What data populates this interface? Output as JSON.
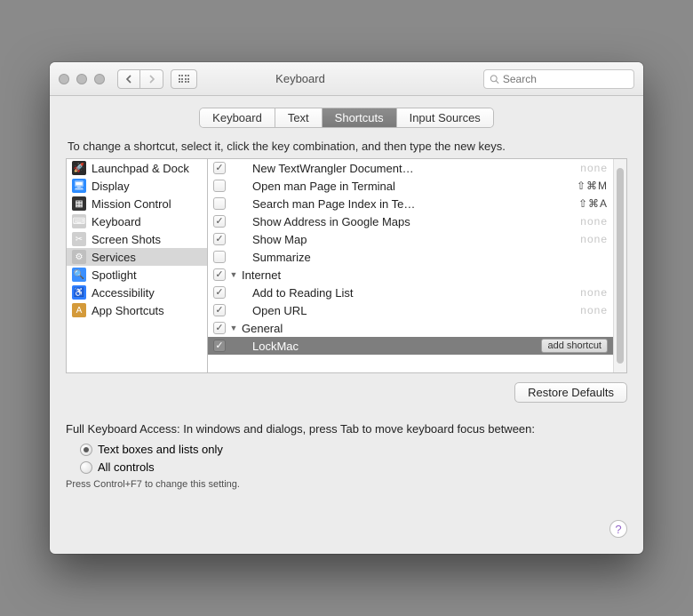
{
  "window": {
    "title": "Keyboard",
    "search_placeholder": "Search"
  },
  "tabs": [
    "Keyboard",
    "Text",
    "Shortcuts",
    "Input Sources"
  ],
  "active_tab_index": 2,
  "instruction": "To change a shortcut, select it, click the key combination, and then type the new keys.",
  "sidebar": {
    "items": [
      {
        "label": "Launchpad & Dock",
        "icon_bg": "#2b2b2b",
        "icon_fg": "🚀"
      },
      {
        "label": "Display",
        "icon_bg": "#2d8cff",
        "icon_fg": "🖥"
      },
      {
        "label": "Mission Control",
        "icon_bg": "#333",
        "icon_fg": "▦"
      },
      {
        "label": "Keyboard",
        "icon_bg": "#cfcfcf",
        "icon_fg": "⌨"
      },
      {
        "label": "Screen Shots",
        "icon_bg": "#cfcfcf",
        "icon_fg": "✂"
      },
      {
        "label": "Services",
        "icon_bg": "#bfbfbf",
        "icon_fg": "⚙"
      },
      {
        "label": "Spotlight",
        "icon_bg": "#3a8fff",
        "icon_fg": "🔍"
      },
      {
        "label": "Accessibility",
        "icon_bg": "#2d7dff",
        "icon_fg": "♿"
      },
      {
        "label": "App Shortcuts",
        "icon_bg": "#d49a3a",
        "icon_fg": "A"
      }
    ],
    "selected_index": 5
  },
  "detail": {
    "rows": [
      {
        "type": "item",
        "checked": true,
        "label": "New TextWrangler Document…",
        "shortcut": "none",
        "indent": 1
      },
      {
        "type": "item",
        "checked": false,
        "label": "Open man Page in Terminal",
        "shortcut": "⇧⌘M",
        "indent": 1
      },
      {
        "type": "item",
        "checked": false,
        "label": "Search man Page Index in Te…",
        "shortcut": "⇧⌘A",
        "indent": 1
      },
      {
        "type": "item",
        "checked": true,
        "label": "Show Address in Google Maps",
        "shortcut": "none",
        "indent": 1
      },
      {
        "type": "item",
        "checked": true,
        "label": "Show Map",
        "shortcut": "none",
        "indent": 1
      },
      {
        "type": "item",
        "checked": false,
        "label": "Summarize",
        "shortcut": "",
        "indent": 1
      },
      {
        "type": "group",
        "checked": true,
        "label": "Internet"
      },
      {
        "type": "item",
        "checked": true,
        "label": "Add to Reading List",
        "shortcut": "none",
        "indent": 1
      },
      {
        "type": "item",
        "checked": true,
        "label": "Open URL",
        "shortcut": "none",
        "indent": 1
      },
      {
        "type": "group",
        "checked": true,
        "label": "General"
      },
      {
        "type": "item",
        "checked": true,
        "label": "LockMac",
        "shortcut": "add shortcut",
        "indent": 1,
        "selected": true
      }
    ]
  },
  "buttons": {
    "restore_defaults": "Restore Defaults",
    "add_shortcut": "add shortcut"
  },
  "fka": {
    "heading": "Full Keyboard Access: In windows and dialogs, press Tab to move keyboard focus between:",
    "option1": "Text boxes and lists only",
    "option2": "All controls",
    "selected": 0,
    "note": "Press Control+F7 to change this setting."
  }
}
